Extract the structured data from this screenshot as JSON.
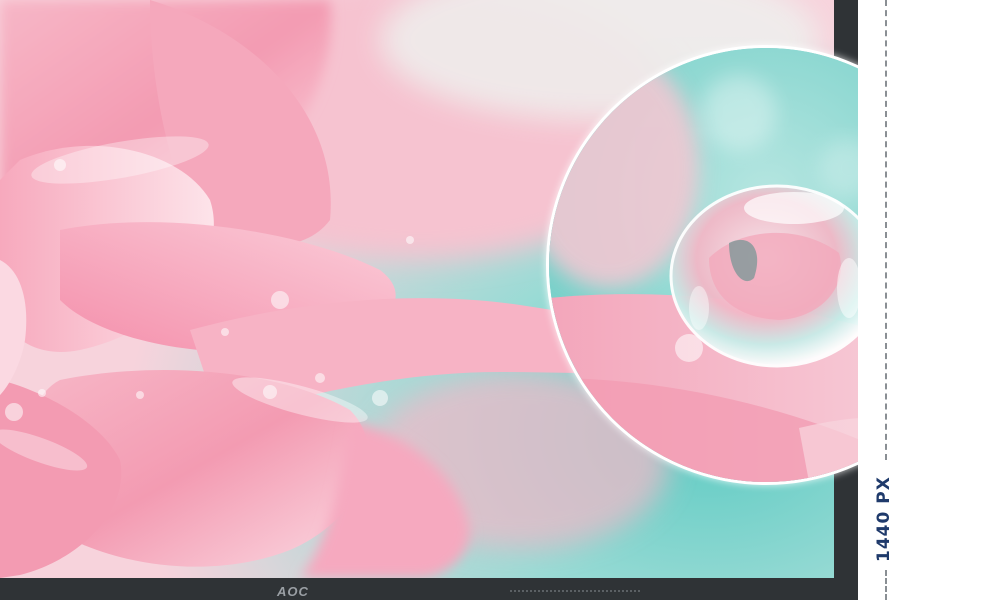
{
  "monitor": {
    "brand": "AOC"
  },
  "dimension": {
    "label": "1440 PX"
  },
  "colors": {
    "petal_pink": "#f3a3b8",
    "petal_light": "#fbe0e7",
    "teal": "#7fd3cc",
    "bezel": "#2f3336",
    "label_blue": "#1f3a6b"
  }
}
